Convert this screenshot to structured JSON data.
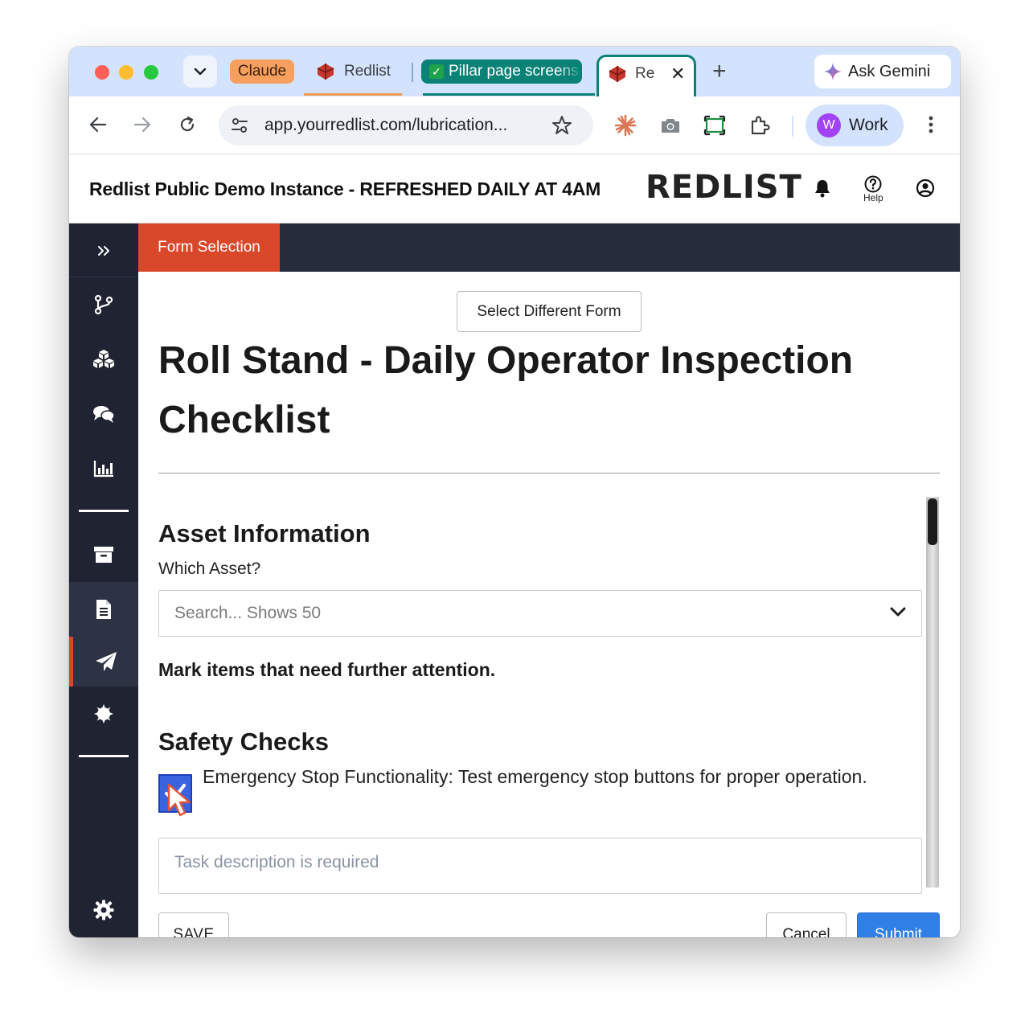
{
  "browser": {
    "tabs": [
      {
        "label": "Claude"
      },
      {
        "label": "Redlist"
      },
      {
        "label": "Pillar page screens"
      },
      {
        "label": "Re"
      }
    ],
    "gemini_label": "Ask Gemini",
    "url": "app.yourredlist.com/lubrication...",
    "profile_initial": "W",
    "profile_label": "Work"
  },
  "header": {
    "title": "Redlist Public Demo Instance - REFRESHED DAILY AT 4AM",
    "logo": "REDLIST",
    "help_label": "Help"
  },
  "topbar": {
    "active_tab": "Form Selection"
  },
  "form": {
    "select_button": "Select Different Form",
    "title": "Roll Stand - Daily Operator Inspection Checklist",
    "asset_section": {
      "heading": "Asset Information",
      "field_label": "Which Asset?",
      "placeholder": "Search... Shows 50"
    },
    "instruction": "Mark items that need further attention.",
    "safety_section": {
      "heading": "Safety Checks",
      "item_text": "Emergency Stop Functionality: Test emergency stop buttons for proper operation.",
      "item_checked": true,
      "task_placeholder": "Task description is required"
    },
    "buttons": {
      "save": "SAVE",
      "cancel": "Cancel",
      "submit": "Submit"
    }
  },
  "sidebar": {
    "icons": [
      "expand-icon",
      "workflow-icon",
      "cubes-icon",
      "comments-icon",
      "chart-icon",
      "archive-icon",
      "document-icon",
      "send-icon",
      "gear-burst-icon",
      "settings-icon"
    ],
    "active_index": 7
  },
  "colors": {
    "accent": "#d9472b",
    "sidebar_bg": "#1f2332",
    "topbar_bg": "#272c3c",
    "submit_blue": "#2f7fe6",
    "tab_teal": "#0b8276"
  }
}
